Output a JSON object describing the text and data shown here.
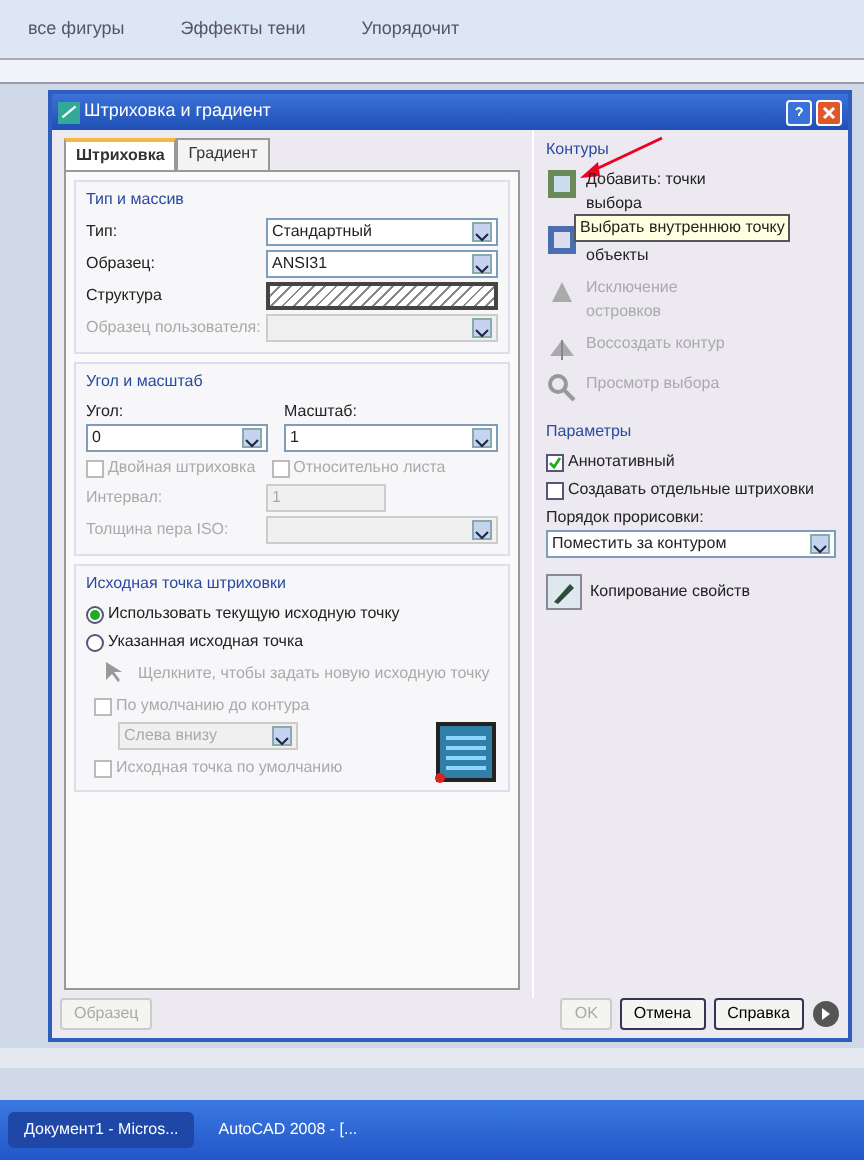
{
  "background": {
    "toolbar": [
      "все фигуры",
      "Эффекты тени",
      "Упорядочит"
    ]
  },
  "dialog": {
    "title": "Штриховка и градиент",
    "tabs": [
      {
        "label": "Штриховка",
        "selected": true
      },
      {
        "label": "Градиент",
        "selected": false
      }
    ],
    "type_group": {
      "title": "Тип и массив",
      "type": {
        "label": "Тип:",
        "value": "Стандартный"
      },
      "pattern": {
        "label": "Образец:",
        "value": "ANSI31"
      },
      "swatch": {
        "label": "Структура"
      },
      "custom": {
        "label": "Образец пользователя:",
        "disabled": true
      }
    },
    "angle_group": {
      "title": "Угол и масштаб",
      "angle": {
        "label": "Угол:",
        "value": "0"
      },
      "scale": {
        "label": "Масштаб:",
        "value": "1"
      },
      "checks": [
        {
          "label": "Двойная штриховка",
          "checked": false,
          "disabled": true
        },
        {
          "label": "Относительно листа",
          "checked": false,
          "disabled": true
        }
      ],
      "spacing": {
        "label": "Интервал:",
        "value": "1",
        "disabled": true
      },
      "pen": {
        "label": "Толщина пера ISO:",
        "disabled": true
      }
    },
    "origin_group": {
      "title": "Исходная точка штриховки",
      "radios": [
        {
          "label": "Использовать текущую исходную точку",
          "selected": true
        },
        {
          "label": "Указанная исходная точка",
          "selected": false
        }
      ],
      "pick": {
        "label": "Щелкните, чтобы задать новую исходную точку",
        "disabled": true
      },
      "extents": {
        "label": "По умолчанию до контура",
        "checked": false,
        "disabled": true
      },
      "position": {
        "value": "Слева внизу",
        "disabled": true
      },
      "store": {
        "label": "Исходная точка по умолчанию",
        "checked": false,
        "disabled": true
      }
    },
    "boundaries": {
      "title": "Контуры",
      "tooltip": "Выбрать внутреннюю точку",
      "items": [
        {
          "label": "Добавить: точки выбора",
          "disabled": false
        },
        {
          "label": "объекты",
          "disabled": false
        },
        {
          "label": "Исключение островков",
          "disabled": true
        },
        {
          "label": "Воссоздать контур",
          "disabled": true
        },
        {
          "label": "Просмотр выбора",
          "disabled": true
        }
      ]
    },
    "options": {
      "title": "Параметры",
      "checks": [
        {
          "label": "Аннотативный",
          "checked": true
        },
        {
          "label": "Создавать отдельные штриховки",
          "checked": false
        }
      ],
      "draw_order": {
        "label": "Порядок прорисовки:",
        "value": "Поместить за контуром"
      }
    },
    "inherit": {
      "label": "Копирование свойств"
    },
    "buttons": [
      {
        "label": "Образец",
        "disabled": true
      },
      {
        "label": "OK",
        "disabled": true
      },
      {
        "label": "Отмена",
        "disabled": false
      },
      {
        "label": "Справка",
        "disabled": false
      }
    ]
  },
  "taskbar": [
    "Документ1 - Micros...",
    "AutoCAD 2008 - [..."
  ]
}
